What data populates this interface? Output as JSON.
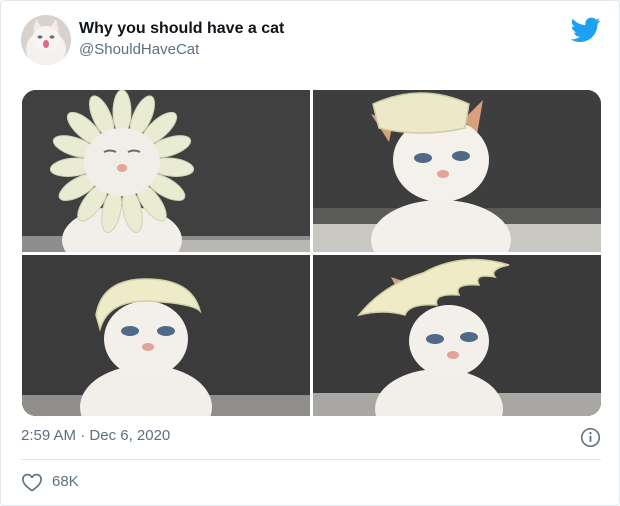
{
  "tweet": {
    "author_name": "Why you should have a cat",
    "author_handle": "@ShouldHaveCat",
    "time": "2:59 AM",
    "separator": "·",
    "date": "Dec 6, 2020",
    "like_count": "68K"
  },
  "icons": {
    "brand": "twitter-bird-icon",
    "info": "info-icon",
    "like": "heart-icon"
  },
  "colors": {
    "brand_blue": "#1da1f2",
    "secondary_text": "#5b7083",
    "primary_text": "#0f1419",
    "divider": "#e1e8ed"
  }
}
